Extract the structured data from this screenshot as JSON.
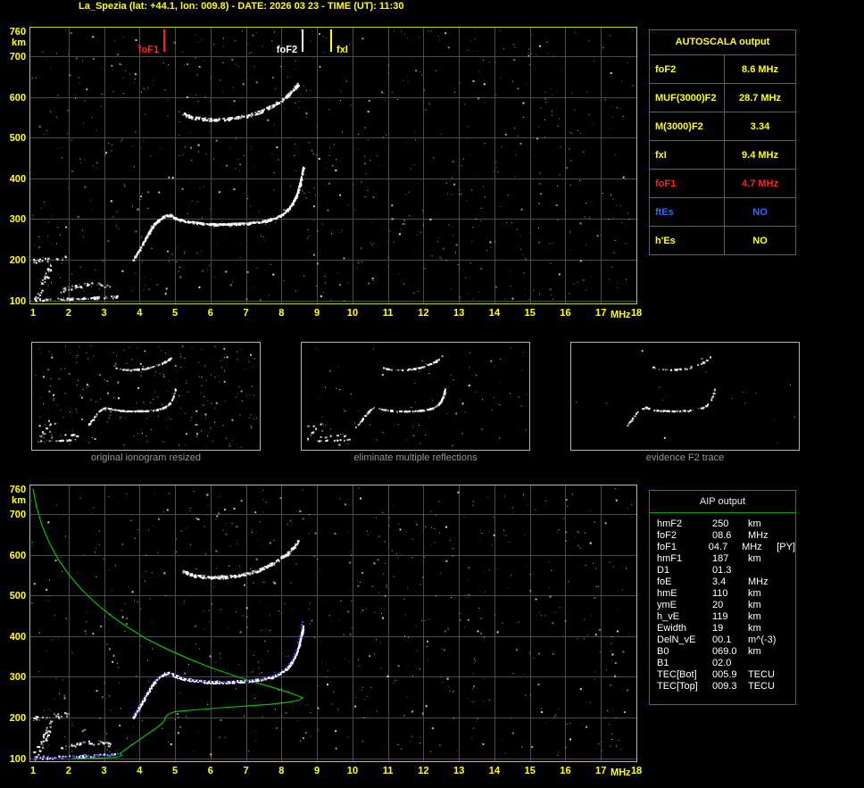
{
  "title": "La_Spezia (lat: +44.1, lon: 009.8) - DATE: 2026 03 23 - TIME (UT): 11:30",
  "colors": {
    "background": "#000000",
    "title_yellow": "#ffff00",
    "axis_yellow": "#ffff00",
    "grid_gray": "#4b4b4b",
    "plot_border": "#cfcf00",
    "table_border_green": "#00a000",
    "alert_red": "#ff1f1f",
    "info_blue": "#3366ff",
    "echo_white": "#ffffff",
    "profile_green": "#00c000",
    "restored_blue": "#3434ff",
    "caption_gray": "#969696"
  },
  "autoscala": {
    "header": "AUTOSCALA output",
    "rows": [
      {
        "label": "foF2",
        "value": "8.6 MHz",
        "color": "yellow"
      },
      {
        "label": "MUF(3000)F2",
        "value": "28.7 MHz",
        "color": "yellow"
      },
      {
        "label": "M(3000)F2",
        "value": "3.34",
        "color": "yellow"
      },
      {
        "label": "fxI",
        "value": "9.4 MHz",
        "color": "yellow"
      },
      {
        "label": "foF1",
        "value": "4.7 MHz",
        "color": "red"
      },
      {
        "label": "ftEs",
        "value": "NO",
        "color": "blue"
      },
      {
        "label": "h'Es",
        "value": "NO",
        "color": "yellow"
      }
    ]
  },
  "aip": {
    "header": "AIP output",
    "rows": [
      {
        "label": "hmF2",
        "value": "250",
        "unit": "km",
        "note": ""
      },
      {
        "label": "foF2",
        "value": "08.6",
        "unit": "MHz",
        "note": ""
      },
      {
        "label": "foF1",
        "value": "04.7",
        "unit": "MHz",
        "note": "[PY]"
      },
      {
        "label": "hmF1",
        "value": "187",
        "unit": "km",
        "note": ""
      },
      {
        "label": "D1",
        "value": "01.3",
        "unit": "",
        "note": ""
      },
      {
        "label": "foE",
        "value": "3.4",
        "unit": "MHz",
        "note": ""
      },
      {
        "label": "hmE",
        "value": "110",
        "unit": "km",
        "note": ""
      },
      {
        "label": "ymE",
        "value": "20",
        "unit": "km",
        "note": ""
      },
      {
        "label": "h_vE",
        "value": "119",
        "unit": "km",
        "note": ""
      },
      {
        "label": "Ewidth",
        "value": "19",
        "unit": "km",
        "note": ""
      },
      {
        "label": "DelN_vE",
        "value": "00.1",
        "unit": "m^(-3)",
        "note": ""
      },
      {
        "label": "B0",
        "value": "069.0",
        "unit": "km",
        "note": ""
      },
      {
        "label": "B1",
        "value": "02.0",
        "unit": "",
        "note": ""
      },
      {
        "label": "TEC[Bot]",
        "value": "005.9",
        "unit": "TECU",
        "note": ""
      },
      {
        "label": "TEC[Top]",
        "value": "009.3",
        "unit": "TECU",
        "note": ""
      }
    ]
  },
  "thumbnails": [
    {
      "caption": "original ionogram resized",
      "render": {
        "include": [
          0,
          1,
          2,
          3,
          4,
          5
        ],
        "density_mul": 0.5,
        "noise": 260,
        "seed": 3
      }
    },
    {
      "caption": "eliminate multiple reflections",
      "render": {
        "include": [
          0,
          1,
          2,
          3,
          4,
          5
        ],
        "density_mul": 0.45,
        "noise": 85,
        "seed": 4
      }
    },
    {
      "caption": "evidence F2 trace",
      "render": {
        "include": [
          3,
          4
        ],
        "density_mul": 0.28,
        "noise": 18,
        "seed": 5
      }
    }
  ],
  "chart_data": [
    {
      "id": "main_ionogram",
      "type": "scatter",
      "title": "Measured ionogram with AUTOSCALA frequency markers",
      "xlabel": "MHz",
      "ylabel": "km",
      "xlim": [
        1,
        18
      ],
      "ylim": [
        100,
        760
      ],
      "x_ticks": [
        1,
        2,
        3,
        4,
        5,
        6,
        7,
        8,
        9,
        10,
        11,
        12,
        13,
        14,
        15,
        16,
        17,
        18
      ],
      "y_ticks": [
        760,
        700,
        600,
        500,
        400,
        300,
        200,
        100
      ],
      "grid": true,
      "markers": [
        {
          "name": "foF1",
          "freq": 4.7,
          "color": "#ff1f1f",
          "label_side": "left"
        },
        {
          "name": "foF2",
          "freq": 8.6,
          "color": "#ffffff",
          "label_side": "left"
        },
        {
          "name": "fxI",
          "freq": 9.4,
          "color": "#ffff00",
          "label_side": "right"
        }
      ],
      "series": [
        {
          "name": "E-region echoes",
          "density": 0.8,
          "jitter_km": 3,
          "points": [
            [
              1.05,
              103
            ],
            [
              1.6,
              104
            ],
            [
              2.2,
              106
            ],
            [
              2.8,
              108
            ],
            [
              3.4,
              111
            ]
          ]
        },
        {
          "name": "Es patches",
          "density": 0.7,
          "jitter_km": 5,
          "points": [
            [
              1.75,
              125
            ],
            [
              2.1,
              133
            ],
            [
              2.5,
              140
            ],
            [
              2.9,
              141
            ],
            [
              3.2,
              134
            ]
          ]
        },
        {
          "name": "E second hop patch",
          "density": 0.55,
          "jitter_km": 6,
          "points": [
            [
              1.0,
              198
            ],
            [
              1.5,
              204
            ],
            [
              2.0,
              209
            ]
          ]
        },
        {
          "name": "F1-F2 trace",
          "density": 2.3,
          "jitter_km": 2.5,
          "points": [
            [
              3.8,
              200
            ],
            [
              3.95,
              222
            ],
            [
              4.1,
              245
            ],
            [
              4.25,
              268
            ],
            [
              4.4,
              288
            ],
            [
              4.55,
              301
            ],
            [
              4.7,
              309
            ],
            [
              4.85,
              311
            ],
            [
              5.0,
              303
            ],
            [
              5.25,
              296
            ],
            [
              5.55,
              292
            ],
            [
              5.9,
              289
            ],
            [
              6.3,
              288
            ],
            [
              6.7,
              289
            ],
            [
              7.1,
              291
            ],
            [
              7.5,
              296
            ],
            [
              7.8,
              303
            ],
            [
              8.05,
              315
            ],
            [
              8.25,
              333
            ],
            [
              8.4,
              357
            ],
            [
              8.5,
              385
            ],
            [
              8.56,
              412
            ],
            [
              8.6,
              428
            ]
          ]
        },
        {
          "name": "F2 second reflection",
          "density": 1.7,
          "jitter_km": 3.5,
          "points": [
            [
              5.2,
              560
            ],
            [
              5.5,
              550
            ],
            [
              6.0,
              545
            ],
            [
              6.5,
              547
            ],
            [
              7.0,
              554
            ],
            [
              7.4,
              565
            ],
            [
              7.8,
              582
            ],
            [
              8.1,
              600
            ],
            [
              8.3,
              617
            ],
            [
              8.45,
              633
            ]
          ]
        },
        {
          "name": "near-range clutter",
          "density": 0.9,
          "jitter_km": 15,
          "points": [
            [
              1.0,
              105
            ],
            [
              1.2,
              130
            ],
            [
              1.35,
              160
            ],
            [
              1.5,
              185
            ]
          ]
        }
      ],
      "render": {
        "noise_points": 750,
        "seed": 11
      }
    },
    {
      "id": "restored_ionogram",
      "type": "scatter",
      "title": "Ionogram with restored trace and electron density profile",
      "xlabel": "MHz",
      "ylabel": "km",
      "xlim": [
        1,
        18
      ],
      "ylim": [
        100,
        760
      ],
      "series_ref": "main_ionogram",
      "restored_trace": {
        "name": "restored trace",
        "color": "#3434ff",
        "segments": [
          [
            [
              1.05,
              100
            ],
            [
              1.35,
              101
            ],
            [
              1.65,
              102
            ],
            [
              1.95,
              103
            ],
            [
              2.25,
              104
            ],
            [
              2.55,
              106
            ],
            [
              2.85,
              107
            ],
            [
              3.15,
              109
            ],
            [
              3.4,
              111
            ]
          ],
          [
            [
              3.85,
              206
            ],
            [
              4.0,
              228
            ],
            [
              4.15,
              252
            ],
            [
              4.3,
              274
            ],
            [
              4.45,
              292
            ],
            [
              4.6,
              303
            ],
            [
              4.75,
              309
            ],
            [
              4.9,
              306
            ],
            [
              5.1,
              299
            ],
            [
              5.35,
              294
            ],
            [
              5.65,
              290
            ],
            [
              6.0,
              288
            ],
            [
              6.35,
              288
            ],
            [
              6.7,
              289
            ],
            [
              7.05,
              291
            ],
            [
              7.4,
              295
            ],
            [
              7.7,
              300
            ],
            [
              7.95,
              309
            ],
            [
              8.15,
              322
            ],
            [
              8.3,
              340
            ],
            [
              8.42,
              365
            ],
            [
              8.5,
              393
            ],
            [
              8.56,
              420
            ],
            [
              8.6,
              435
            ]
          ]
        ]
      },
      "profile": {
        "name": "plasma frequency profile N(h)",
        "color": "#00c000",
        "points": [
          [
            1.0,
            762
          ],
          [
            1.1,
            716
          ],
          [
            1.25,
            672
          ],
          [
            1.45,
            630
          ],
          [
            1.7,
            590
          ],
          [
            2.0,
            552
          ],
          [
            2.35,
            516
          ],
          [
            2.75,
            482
          ],
          [
            3.2,
            450
          ],
          [
            3.7,
            420
          ],
          [
            4.2,
            393
          ],
          [
            4.8,
            367
          ],
          [
            5.4,
            344
          ],
          [
            6.0,
            323
          ],
          [
            6.6,
            305
          ],
          [
            7.2,
            288
          ],
          [
            7.8,
            273
          ],
          [
            8.2,
            262
          ],
          [
            8.45,
            254
          ],
          [
            8.6,
            249
          ],
          [
            8.5,
            243
          ],
          [
            8.2,
            238
          ],
          [
            7.7,
            233
          ],
          [
            7.1,
            229
          ],
          [
            6.4,
            225
          ],
          [
            5.7,
            220
          ],
          [
            5.0,
            215
          ],
          [
            4.8,
            208
          ],
          [
            4.72,
            200
          ],
          [
            4.7,
            193
          ],
          [
            4.65,
            187
          ],
          [
            4.5,
            176
          ],
          [
            4.3,
            164
          ],
          [
            4.1,
            152
          ],
          [
            3.9,
            140
          ],
          [
            3.7,
            128
          ],
          [
            3.55,
            118
          ],
          [
            3.45,
            112
          ],
          [
            3.5,
            108
          ],
          [
            3.42,
            104
          ],
          [
            3.2,
            102
          ],
          [
            2.9,
            101
          ],
          [
            2.5,
            100
          ],
          [
            2.1,
            100
          ]
        ]
      },
      "render": {
        "noise_points": 700,
        "seed": 23
      }
    }
  ]
}
